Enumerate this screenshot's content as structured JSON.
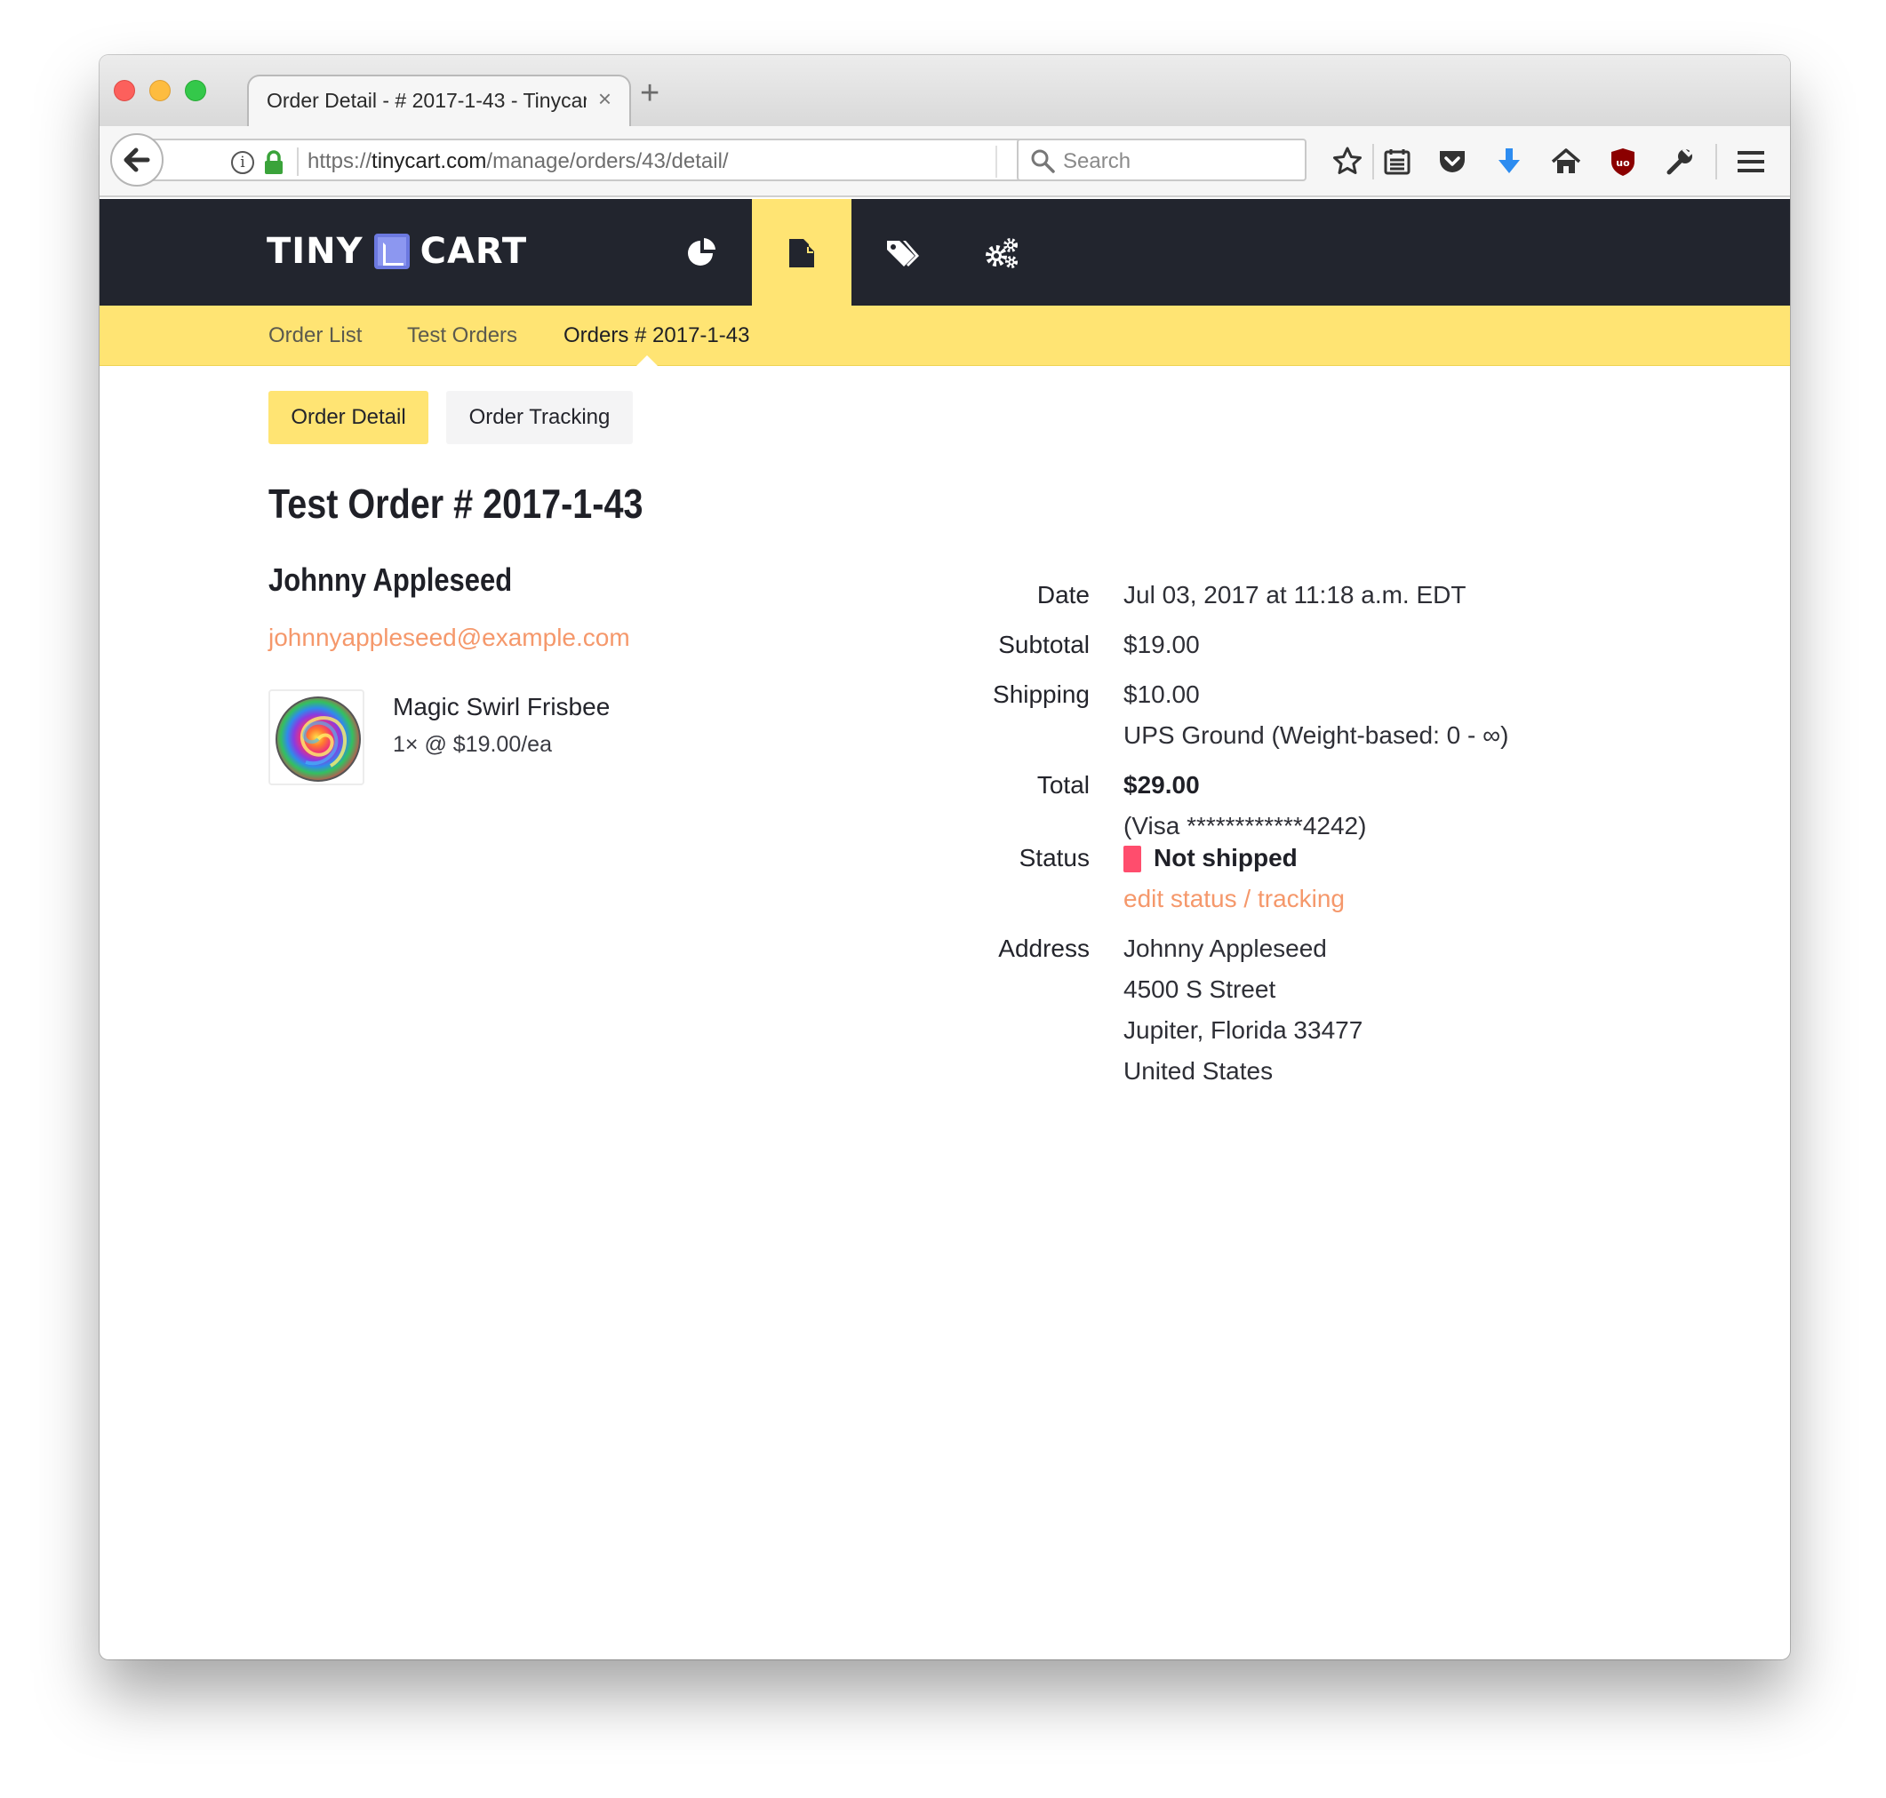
{
  "browser": {
    "tab_title": "Order Detail - # 2017-1-43 - Tinycart",
    "tab_close": "×",
    "new_tab": "+",
    "url_prefix": "https://",
    "url_domain": "tinycart.com",
    "url_path": "/manage/orders/43/detail/",
    "search_placeholder": "Search"
  },
  "app": {
    "logo_left": "TINY",
    "logo_right": "CART",
    "nav": [
      {
        "icon": "pie-chart-icon",
        "active": false
      },
      {
        "icon": "orders-icon",
        "active": true
      },
      {
        "icon": "tags-icon",
        "active": false
      },
      {
        "icon": "settings-icon",
        "active": false
      }
    ],
    "accent_color": "#ffe473",
    "header_color": "#22252e"
  },
  "subnav": {
    "items": [
      "Order List",
      "Test Orders",
      "Orders # 2017-1-43"
    ]
  },
  "tabs": {
    "detail": "Order Detail",
    "tracking": "Order Tracking"
  },
  "order": {
    "title": "Test Order # 2017-1-43",
    "customer_name": "Johnny Appleseed",
    "customer_email": "johnnyappleseed@example.com",
    "item": {
      "name": "Magic Swirl Frisbee",
      "quantity_line": "1× @ $19.00/ea"
    },
    "labels": {
      "date": "Date",
      "subtotal": "Subtotal",
      "shipping": "Shipping",
      "total": "Total",
      "status": "Status",
      "address": "Address"
    },
    "date": "Jul 03, 2017 at 11:18 a.m. EDT",
    "subtotal": "$19.00",
    "shipping": "$10.00",
    "shipping_method": "UPS Ground (Weight-based: 0 - ∞)",
    "total": "$29.00",
    "payment": "(Visa ************4242)",
    "status": "Not shipped",
    "status_color": "#ff4d6d",
    "status_link": "edit status / tracking",
    "address": [
      "Johnny Appleseed",
      "4500 S Street",
      "Jupiter, Florida 33477",
      "United States"
    ]
  }
}
